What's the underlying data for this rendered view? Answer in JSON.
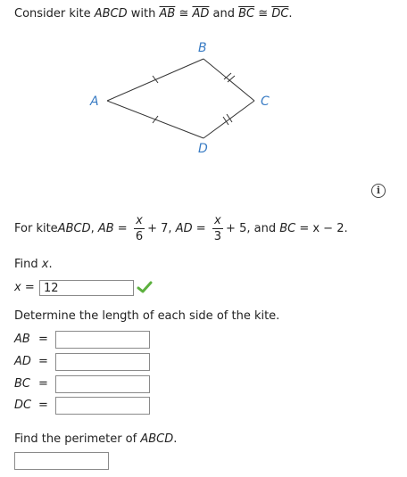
{
  "problem": {
    "intro_prefix": "Consider kite ",
    "intro_kite": "ABCD",
    "intro_with": " with ",
    "seg1": "AB",
    "cong1": " ≅ ",
    "seg2": "AD",
    "and": " and ",
    "seg3": "BC",
    "cong2": " ≅ ",
    "seg4": "DC",
    "period": "."
  },
  "figure": {
    "label_A": "A",
    "label_B": "B",
    "label_C": "C",
    "label_D": "D",
    "label_color": "#3a7cc4"
  },
  "info_icon": "i",
  "given": {
    "prefix": "For kite ",
    "kite": "ABCD",
    "comma1": ", ",
    "ab": "AB",
    "eq1": " = ",
    "f1_num": "x",
    "f1_den": "6",
    "plus1": "+ 7, ",
    "ad": "AD",
    "eq2": " = ",
    "f2_num": "x",
    "f2_den": "3",
    "plus2": "+ 5, and ",
    "bc": "BC",
    "eq3": " = x − 2."
  },
  "find_x": {
    "label_prefix": "Find ",
    "var": "x",
    "label_suffix": ".",
    "input_label": "x =",
    "input_value": "12",
    "status": "correct"
  },
  "sides": {
    "prompt": "Determine the length of each side of the kite.",
    "rows": [
      {
        "label": "AB",
        "eq": "=",
        "value": ""
      },
      {
        "label": "AD",
        "eq": "=",
        "value": ""
      },
      {
        "label": "BC",
        "eq": "=",
        "value": ""
      },
      {
        "label": "DC",
        "eq": "=",
        "value": ""
      }
    ]
  },
  "perimeter": {
    "prefix": "Find the perimeter of ",
    "kite": "ABCD",
    "suffix": ".",
    "value": ""
  }
}
